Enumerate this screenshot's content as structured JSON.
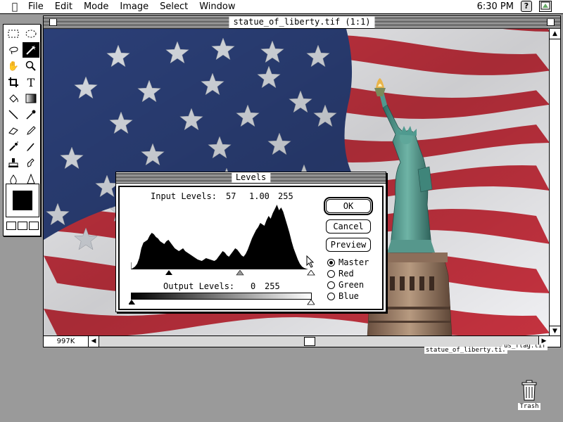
{
  "menubar": {
    "apple": "",
    "items": [
      "File",
      "Edit",
      "Mode",
      "Image",
      "Select",
      "Window"
    ],
    "clock": "6:30 PM",
    "help": "?"
  },
  "document": {
    "title": "statue_of_liberty.tif  (1:1)",
    "doc_size": "997K"
  },
  "levels_dialog": {
    "title": "Levels",
    "input_label": "Input Levels:",
    "input_black": "57",
    "input_gamma": "1.00",
    "input_white": "255",
    "output_label": "Output Levels:",
    "output_black": "0",
    "output_white": "255",
    "buttons": {
      "ok": "OK",
      "cancel": "Cancel",
      "preview": "Preview"
    },
    "channels": [
      {
        "label": "Master",
        "selected": true
      },
      {
        "label": "Red",
        "selected": false
      },
      {
        "label": "Green",
        "selected": false
      },
      {
        "label": "Blue",
        "selected": false
      }
    ]
  },
  "desktop": {
    "file_label_1": "statue_of_liberty.tif",
    "file_label_2": "us_flag.tif",
    "trash_label": "Trash"
  },
  "colors": {
    "flag_blue": "#2b3f77",
    "flag_red": "#c4323f",
    "statue_green": "#4f9a8f"
  }
}
